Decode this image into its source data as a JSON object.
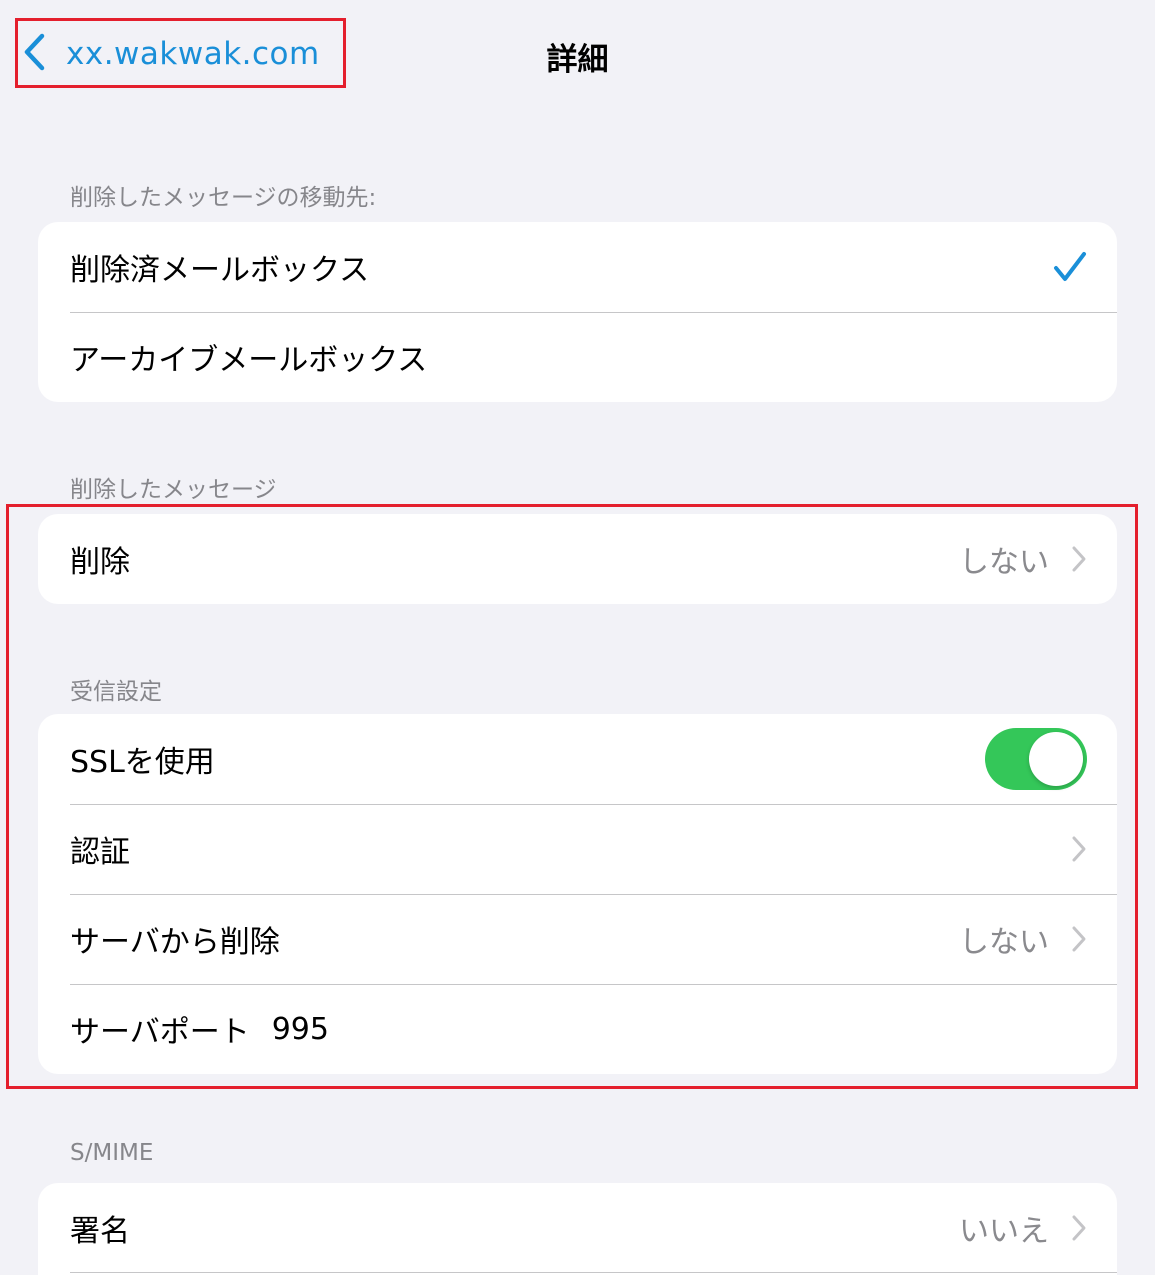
{
  "nav": {
    "back_label": "xx.wakwak.com",
    "title": "詳細"
  },
  "sections": {
    "move_to": {
      "header": "削除したメッセージの移動先:",
      "items": [
        {
          "label": "削除済メールボックス",
          "checked": true
        },
        {
          "label": "アーカイブメールボックス",
          "checked": false
        }
      ]
    },
    "deleted": {
      "header": "削除したメッセージ",
      "items": [
        {
          "label": "削除",
          "value": "しない"
        }
      ]
    },
    "incoming": {
      "header": "受信設定",
      "items": [
        {
          "label": "SSLを使用",
          "toggle": true
        },
        {
          "label": "認証",
          "value": ""
        },
        {
          "label": "サーバから削除",
          "value": "しない"
        },
        {
          "label": "サーバポート",
          "value": "995"
        }
      ]
    },
    "smime": {
      "header": "S/MIME",
      "items": [
        {
          "label": "署名",
          "value": "いいえ"
        }
      ]
    }
  },
  "colors": {
    "accent": "#1a8fd8",
    "toggle_on": "#34c759",
    "annotation": "#e41f2d",
    "background": "#f2f2f7"
  }
}
